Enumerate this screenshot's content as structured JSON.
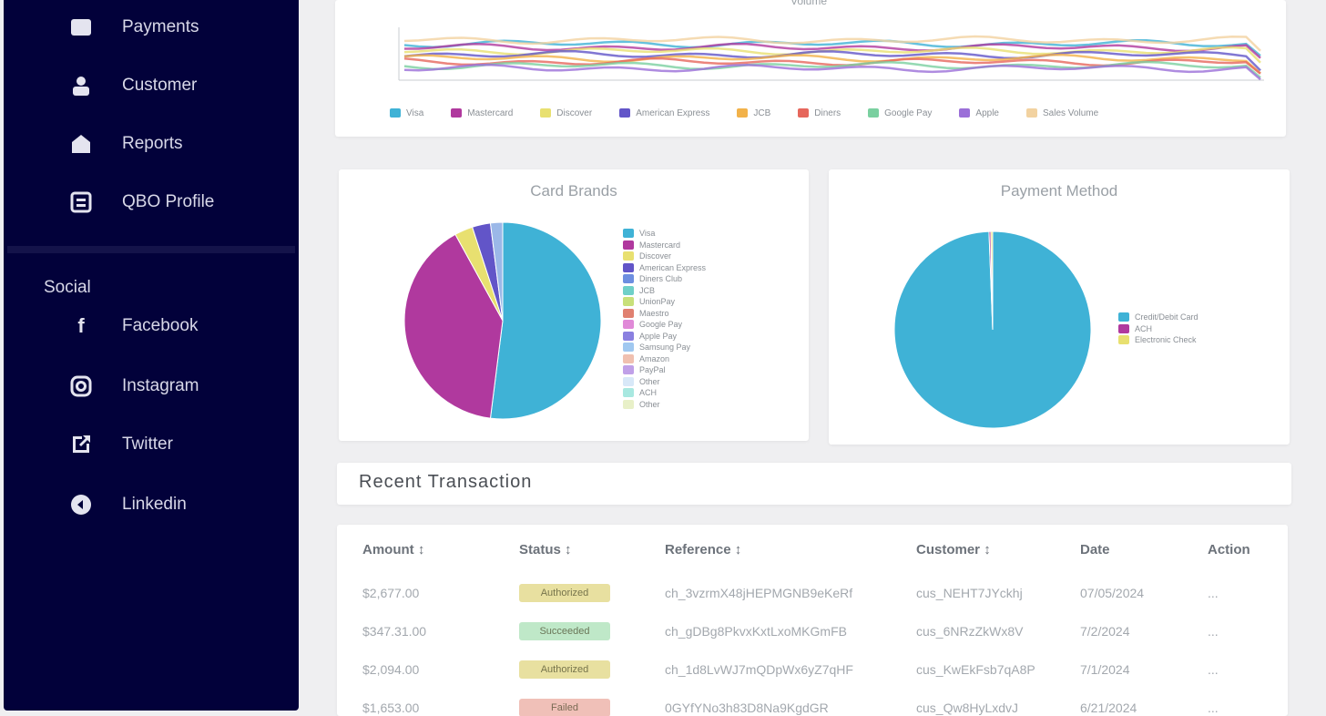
{
  "sidebar": {
    "items": [
      {
        "label": "Payments",
        "icon": "credit-card-icon"
      },
      {
        "label": "Customer",
        "icon": "user-icon"
      },
      {
        "label": "Reports",
        "icon": "reports-icon"
      },
      {
        "label": "QBO Profile",
        "icon": "profile-icon"
      }
    ],
    "social_label": "Social",
    "social_items": [
      {
        "label": "Facebook",
        "icon": "facebook-icon"
      },
      {
        "label": "Instagram",
        "icon": "instagram-icon"
      },
      {
        "label": "Twitter",
        "icon": "twitter-icon"
      },
      {
        "label": "Linkedin",
        "icon": "linkedin-icon"
      }
    ]
  },
  "top_chart": {
    "title": "Volume",
    "legend": [
      "Visa",
      "Mastercard",
      "Discover",
      "American Express",
      "JCB",
      "Diners",
      "Google Pay",
      "Apple",
      "Sales Volume"
    ],
    "colors": [
      "#3fb2d6",
      "#b0399e",
      "#e8e070",
      "#6255c8",
      "#f2b24a",
      "#e6675c",
      "#7ad0a0",
      "#9b6fd8",
      "#f2d2a0"
    ]
  },
  "card_brands": {
    "title": "Card Brands",
    "legend": [
      "Visa",
      "Mastercard",
      "Discover",
      "American Express",
      "Diners Club",
      "JCB",
      "UnionPay",
      "Maestro",
      "Google Pay",
      "Apple Pay",
      "Samsung Pay",
      "Amazon",
      "PayPal",
      "Other",
      "ACH",
      "Other"
    ],
    "chart_data": {
      "type": "pie",
      "categories": [
        "Visa",
        "Mastercard",
        "Discover",
        "American Express",
        "Other"
      ],
      "values": [
        52,
        40,
        3,
        3,
        2
      ],
      "colors": [
        "#3fb2d6",
        "#b0399e",
        "#e8e070",
        "#6255c8",
        "#9bb8e8"
      ]
    },
    "legend_colors": [
      "#3fb2d6",
      "#b0399e",
      "#e8e070",
      "#6255c8",
      "#6d8ee0",
      "#6fd0c8",
      "#c8e07a",
      "#e08070",
      "#e08ad8",
      "#8a80e0",
      "#a0c8f0",
      "#f0c0b0",
      "#c0a0e8",
      "#d8e8f8",
      "#a8e8e0",
      "#e8f0c8"
    ]
  },
  "payment_method": {
    "title": "Payment Method",
    "legend": [
      "Credit/Debit Card",
      "ACH",
      "Electronic Check"
    ],
    "legend_colors": [
      "#3fb2d6",
      "#b0399e",
      "#e8e070"
    ],
    "chart_data": {
      "type": "pie",
      "categories": [
        "Credit/Debit Card",
        "ACH",
        "Electronic Check"
      ],
      "values": [
        99.4,
        0.3,
        0.3
      ],
      "colors": [
        "#3fb2d6",
        "#b0399e",
        "#e8e070"
      ]
    }
  },
  "recent": {
    "title": "Recent Transaction",
    "columns": [
      "Amount",
      "Status",
      "Reference",
      "Customer",
      "Date",
      "Action"
    ],
    "rows": [
      {
        "amount": "$2,677.00",
        "status": "Authorized",
        "status_color": "#e8e0a0",
        "reference": "ch_3vzrmX48jHEPMGNB9eKeRf",
        "customer": "cus_NEHT7JYckhj",
        "date": "07/05/2024",
        "action": "..."
      },
      {
        "amount": "$347.31.00",
        "status": "Succeeded",
        "status_color": "#bfe8c8",
        "reference": "ch_gDBg8PkvxKxtLxoMKGmFB",
        "customer": "cus_6NRzZkWx8V",
        "date": "7/2/2024",
        "action": "..."
      },
      {
        "amount": "$2,094.00",
        "status": "Authorized",
        "status_color": "#e8e0a0",
        "reference": "ch_1d8LvWJ7mQDpWx6yZ7qHF",
        "customer": "cus_KwEkFsb7qA8P",
        "date": "7/1/2024",
        "action": "..."
      },
      {
        "amount": "$1,653.00",
        "status": "Failed",
        "status_color": "#f0c0b8",
        "reference": "0GYfYNo3h83D8Na9KgdGR",
        "customer": "cus_Qw8HyLxdvJ",
        "date": "6/21/2024",
        "action": "..."
      }
    ]
  }
}
